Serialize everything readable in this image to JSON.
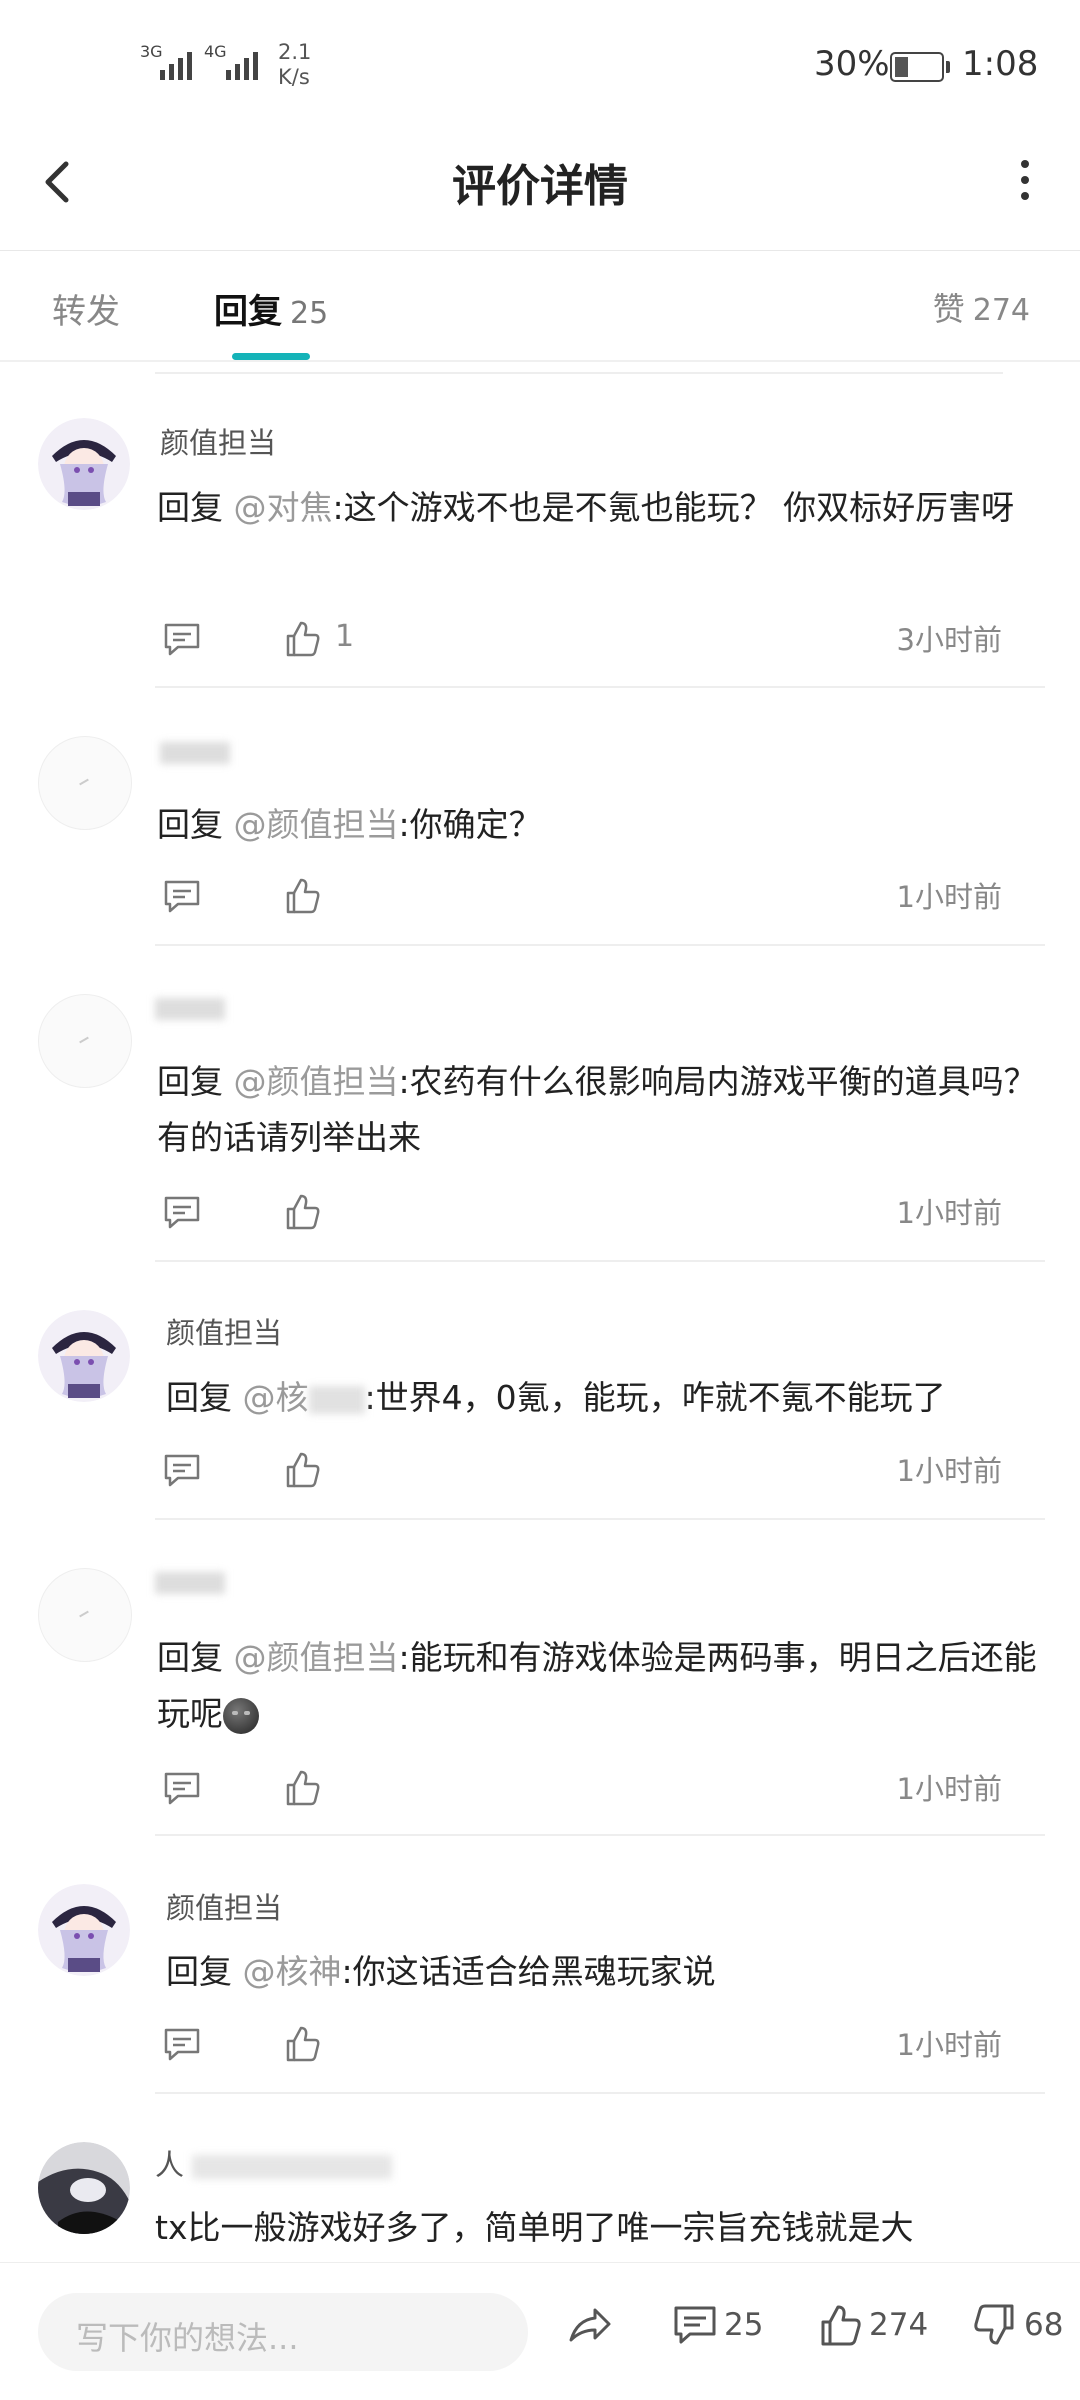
{
  "status": {
    "signal1": "3G",
    "signal2": "4G",
    "speed_value": "2.1",
    "speed_unit": "K/s",
    "battery_pct": "30%",
    "battery_level": 0.3,
    "time": "1:08"
  },
  "header": {
    "title": "评价详情",
    "back_icon": "chevron-left-icon",
    "more_icon": "more-vertical-icon"
  },
  "tabs": {
    "forward_label": "转发",
    "reply_label": "回复",
    "reply_count": "25",
    "like_label": "赞",
    "like_count": "274",
    "accent_color": "#14b3b8"
  },
  "comments": [
    {
      "username": "颜值担当",
      "prefix": "回复 ",
      "at": "@对焦",
      "text": ":这个游戏不也是不氪也能玩？ 你双标好厉害呀",
      "likes": "1",
      "time": "3小时前"
    },
    {
      "username": "",
      "prefix": "回复 ",
      "at": "@颜值担当",
      "text": ":你确定？",
      "likes": "",
      "time": "1小时前"
    },
    {
      "username": "",
      "prefix": "回复 ",
      "at": "@颜值担当",
      "text": ":农药有什么很影响局内游戏平衡的道具吗？有的话请列举出来",
      "likes": "",
      "time": "1小时前"
    },
    {
      "username": "颜值担当",
      "prefix": "回复 ",
      "at": "@核",
      "text": ":世界4，0氪，能玩，咋就不氪不能玩了",
      "likes": "",
      "time": "1小时前"
    },
    {
      "username": "",
      "prefix": "回复 ",
      "at": "@颜值担当",
      "text": ":能玩和有游戏体验是两码事，明日之后还能玩呢",
      "likes": "",
      "time": "1小时前"
    },
    {
      "username": "颜值担当",
      "prefix": "回复 ",
      "at": "@核神",
      "text": ":你这话适合给黑魂玩家说",
      "likes": "",
      "time": "1小时前"
    },
    {
      "username": "人",
      "prefix": "",
      "at": "",
      "text": "tx比一般游戏好多了，简单明了唯一宗旨充钱就是大",
      "likes": "",
      "time": ""
    }
  ],
  "bottom": {
    "placeholder": "写下你的想法...",
    "comment_count": "25",
    "like_count": "274",
    "dislike_count": "68"
  }
}
